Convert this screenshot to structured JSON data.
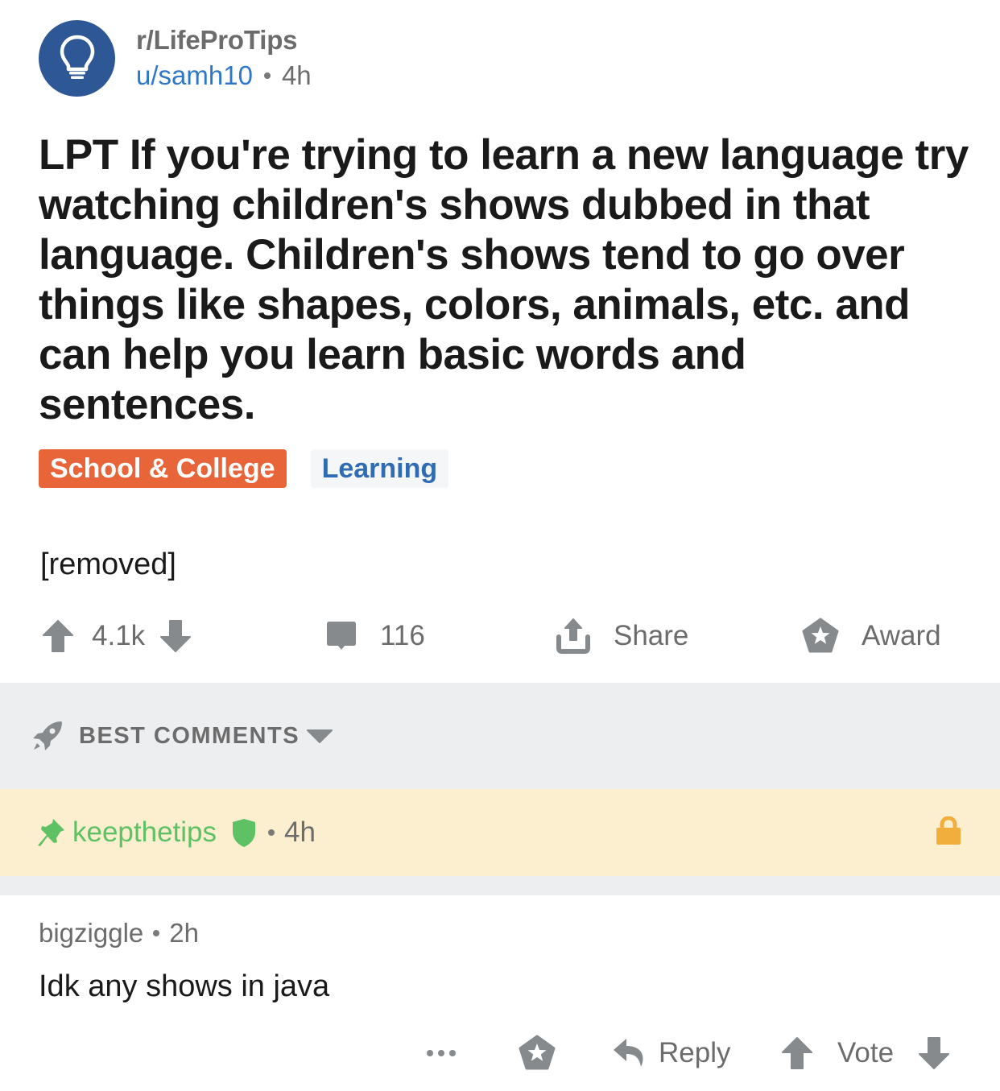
{
  "post": {
    "subreddit": "r/LifeProTips",
    "author": "u/samh10",
    "age": "4h",
    "title": "LPT If you're trying to learn a new language try watching children's shows dubbed in that language. Children's shows tend to go over things like shapes, colors, animals, etc. and can help you learn basic words and sentences.",
    "flairs": [
      {
        "label": "School & College",
        "color": "#e8653a"
      },
      {
        "label": "Learning",
        "color": "#2f6cb3"
      }
    ],
    "body": "[removed]",
    "score": "4.1k",
    "comment_count": "116",
    "share_label": "Share",
    "award_label": "Award"
  },
  "sort": {
    "label": "BEST COMMENTS"
  },
  "stickied_comment": {
    "author": "keepthetips",
    "age": "4h"
  },
  "comments": [
    {
      "author": "bigziggle",
      "age": "2h",
      "body": "Idk any shows in java",
      "more_label": "•••",
      "reply_label": "Reply",
      "vote_label": "Vote"
    }
  ],
  "colors": {
    "subreddit_icon": "#2e5795",
    "author_link": "#2f78c8",
    "moderator_green": "#5ec164",
    "stickied_background": "#fcefcf",
    "lock": "#f2ae3c",
    "icon_gray": "#878a8c"
  }
}
